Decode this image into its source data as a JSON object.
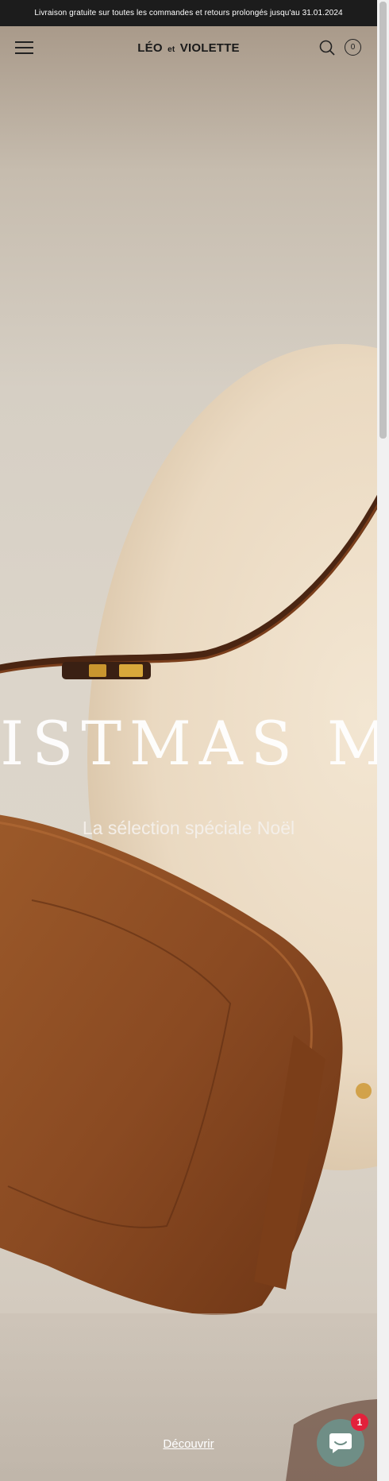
{
  "announcement": {
    "text": "Livraison gratuite sur toutes les commandes et retours prolongés jusqu'au 31.01.2024"
  },
  "header": {
    "logo_main": "LÉO",
    "logo_small": "et",
    "logo_end": "VIOLETTE",
    "cart_count": "0"
  },
  "hero": {
    "title": "ISTMAS M",
    "subtitle": "La sélection spéciale Noël",
    "cta": "Découvrir"
  },
  "chat": {
    "badge": "1"
  },
  "colors": {
    "topbar": "#1c1c1c",
    "bag": "#8a4a22",
    "chat": "#6f8e86",
    "badge": "#e3213b"
  }
}
